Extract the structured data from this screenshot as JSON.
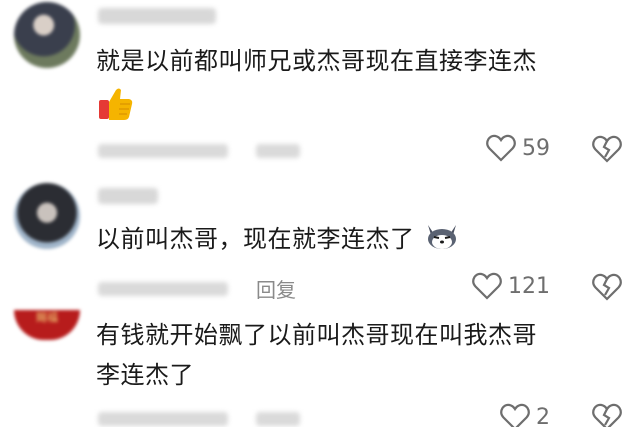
{
  "comments": [
    {
      "text_lines": [
        "就是以前都叫师兄或杰哥现在直接李连杰"
      ],
      "emoji": "thumbs-up-icon",
      "like_count": "59"
    },
    {
      "text_lines": [
        "以前叫杰哥，现在就李连杰了"
      ],
      "emoji": "husky-dog-icon",
      "reply_label": "回复",
      "like_count": "121"
    },
    {
      "text_lines": [
        "有钱就开始飘了以前叫杰哥现在叫我杰哥",
        "李连杰了"
      ],
      "avatar_text": "賜福",
      "like_count": "2"
    }
  ],
  "colors": {
    "text": "#1a1a1a",
    "meta": "#8a8a8a",
    "icon": "#6e6e6e",
    "thumb": "#f5b400",
    "cuff": "#e53935"
  }
}
